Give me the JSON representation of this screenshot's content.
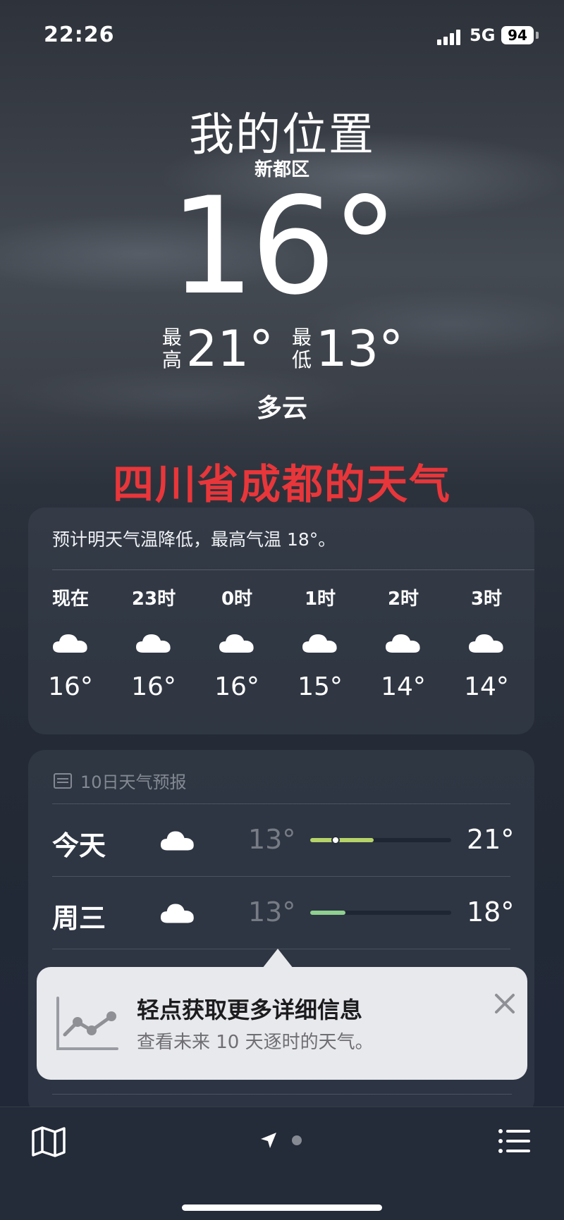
{
  "status": {
    "time": "22:26",
    "network": "5G",
    "battery": "94"
  },
  "location": {
    "title": "我的位置",
    "district": "新都区"
  },
  "current": {
    "temp": "16°",
    "high_label": "最高",
    "high": "21°",
    "low_label": "最低",
    "low": "13°",
    "condition": "多云"
  },
  "overlay_caption": "四川省成都的天气",
  "hourly": {
    "summary": "预计明天气温降低，最高气温 18°。",
    "hours": [
      {
        "label": "现在",
        "icon": "cloud-icon",
        "temp": "16°"
      },
      {
        "label": "23时",
        "icon": "cloud-icon",
        "temp": "16°"
      },
      {
        "label": "0时",
        "icon": "cloud-icon",
        "temp": "16°"
      },
      {
        "label": "1时",
        "icon": "cloud-icon",
        "temp": "15°"
      },
      {
        "label": "2时",
        "icon": "cloud-icon",
        "temp": "14°"
      },
      {
        "label": "3时",
        "icon": "cloud-icon",
        "temp": "14°"
      }
    ]
  },
  "daily": {
    "header": "10日天气预报",
    "days": [
      {
        "name": "今天",
        "icon": "cloud-icon",
        "low": "13°",
        "high": "21°",
        "range_start": 0.0,
        "range_end": 0.45,
        "current_marker": 0.18,
        "bar_color": "#b6d36a"
      },
      {
        "name": "周三",
        "icon": "cloud-icon",
        "low": "13°",
        "high": "18°",
        "range_start": 0.0,
        "range_end": 0.25,
        "bar_color": "#8fd08f"
      }
    ]
  },
  "tooltip": {
    "title": "轻点获取更多详细信息",
    "subtitle": "查看未来 10 天逐时的天气。",
    "icon": "chart-icon"
  },
  "colors": {
    "caption_red": "#e8363a",
    "tooltip_bg": "#e8e9ed"
  }
}
